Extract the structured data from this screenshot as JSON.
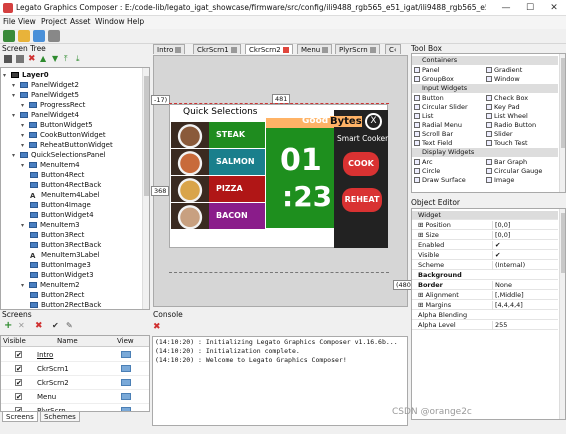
{
  "window": {
    "title": "Legato Graphics Composer : E:/code-lib/legato_igat_showcase/firmware/src/config/ili9488_rgb565_e51_igat/ili9488_rgb565_e51_igat_desig...",
    "minimize": "—",
    "maximize": "☐",
    "close": "✕"
  },
  "menu": [
    "File",
    "View",
    "Project",
    "Asset",
    "Window",
    "Help"
  ],
  "screen_tree": {
    "title": "Screen Tree",
    "items": [
      {
        "label": "Layer0",
        "type": "layer",
        "indent": 0
      },
      {
        "label": "PanelWidget2",
        "type": "widget",
        "indent": 1
      },
      {
        "label": "PanelWidget5",
        "type": "widget",
        "indent": 1
      },
      {
        "label": "ProgressRect",
        "type": "widget",
        "indent": 2
      },
      {
        "label": "PanelWidget4",
        "type": "widget",
        "indent": 1
      },
      {
        "label": "ButtonWidget5",
        "type": "widget",
        "indent": 2
      },
      {
        "label": "CookButtonWidget",
        "type": "widget",
        "indent": 2
      },
      {
        "label": "ReheatButtonWidget",
        "type": "widget",
        "indent": 2
      },
      {
        "label": "QuickSelectionsPanel",
        "type": "widget",
        "indent": 1
      },
      {
        "label": "MenuItem4",
        "type": "widget",
        "indent": 2
      },
      {
        "label": "Button4Rect",
        "type": "widget",
        "indent": 3
      },
      {
        "label": "Button4RectBack",
        "type": "widget",
        "indent": 3
      },
      {
        "label": "MenuItem4Label",
        "type": "label",
        "indent": 3
      },
      {
        "label": "Button4Image",
        "type": "widget",
        "indent": 3
      },
      {
        "label": "ButtonWidget4",
        "type": "widget",
        "indent": 3
      },
      {
        "label": "MenuItem3",
        "type": "widget",
        "indent": 2
      },
      {
        "label": "Button3Rect",
        "type": "widget",
        "indent": 3
      },
      {
        "label": "Button3RectBack",
        "type": "widget",
        "indent": 3
      },
      {
        "label": "MenuItem3Label",
        "type": "label",
        "indent": 3
      },
      {
        "label": "ButtonImage3",
        "type": "widget",
        "indent": 3
      },
      {
        "label": "ButtonWidget3",
        "type": "widget",
        "indent": 3
      },
      {
        "label": "MenuItem2",
        "type": "widget",
        "indent": 2
      },
      {
        "label": "Button2Rect",
        "type": "widget",
        "indent": 3
      },
      {
        "label": "Button2RectBack",
        "type": "widget",
        "indent": 3
      }
    ]
  },
  "tabs": [
    {
      "label": "Intro",
      "active": false
    },
    {
      "label": "CkrScrn1",
      "active": false
    },
    {
      "label": "CkrScrn2",
      "active": true
    },
    {
      "label": "Menu",
      "active": false
    },
    {
      "label": "PlyrScrn",
      "active": false
    },
    {
      "label": "C‹",
      "active": false
    }
  ],
  "canvas": {
    "ruler_width": "481",
    "ruler_height": "368",
    "ruler_left": "-17)",
    "ruler_right": "(480",
    "quick_selections_title": "Quick Selections",
    "menu_items": [
      {
        "label": "STEAK",
        "color": "#1f8c1f",
        "thumb": "#8a5a3a"
      },
      {
        "label": "SALMON",
        "color": "#1a7f8c",
        "thumb": "#c86a3a"
      },
      {
        "label": "PIZZA",
        "color": "#b01616",
        "thumb": "#d9a44a"
      },
      {
        "label": "BACON",
        "color": "#8a1c8a",
        "thumb": "#c8a080"
      }
    ],
    "timer_header": "Good",
    "timer_minutes": "01",
    "timer_seconds": ":23",
    "brand": "Bytes",
    "brand_sub": "Smart Cooker",
    "close_glyph": "X",
    "cook_label": "COOK",
    "reheat_label": "REHEAT"
  },
  "screens": {
    "title": "Screens",
    "columns": [
      "Visible",
      "Name",
      "View"
    ],
    "rows": [
      {
        "name": "Intro",
        "visible": true
      },
      {
        "name": "CkrScrn1",
        "visible": true
      },
      {
        "name": "CkrScrn2",
        "visible": true
      },
      {
        "name": "Menu",
        "visible": true
      },
      {
        "name": "PlyrScrn",
        "visible": true
      }
    ],
    "bottom_tabs": [
      "Screens",
      "Schemes"
    ]
  },
  "console": {
    "title": "Console",
    "lines": [
      "(14:10:20) : Initializing Legato Graphics Composer v1.16.6b...",
      "(14:10:20) : Initialization complete.",
      "(14:10:20) : Welcome to Legato Graphics Composer!"
    ]
  },
  "toolbox": {
    "title": "Tool Box",
    "groups": [
      {
        "name": "Containers",
        "items": [
          "Panel",
          "Gradient",
          "GroupBox",
          "Window"
        ]
      },
      {
        "name": "Input Widgets",
        "items": [
          "Button",
          "Check Box",
          "Circular Slider",
          "Key Pad",
          "List",
          "List Wheel",
          "Radial Menu",
          "Radio Button",
          "Scroll Bar",
          "Slider",
          "Text Field",
          "Touch Test"
        ]
      },
      {
        "name": "Display Widgets",
        "items": [
          "Arc",
          "Bar Graph",
          "Circle",
          "Circular Gauge",
          "Draw Surface",
          "Image"
        ]
      }
    ]
  },
  "object_editor": {
    "title": "Object Editor",
    "rows": [
      {
        "key": "Widget",
        "value": "",
        "group": true
      },
      {
        "key": "⊞ Position",
        "value": "[0,0]",
        "group": false
      },
      {
        "key": "⊞ Size",
        "value": "[0,0]",
        "group": false
      },
      {
        "key": "Enabled",
        "value": "✔",
        "group": false
      },
      {
        "key": "Visible",
        "value": "✔",
        "group": false
      },
      {
        "key": "Scheme",
        "value": "(Internal)",
        "group": false
      },
      {
        "key": "Background",
        "value": "",
        "group": false
      },
      {
        "key": "Border",
        "value": "None",
        "group": false
      },
      {
        "key": "⊞ Alignment",
        "value": "[,Middle]",
        "group": false
      },
      {
        "key": "⊞ Margins",
        "value": "[4,4,4,4]",
        "group": false
      },
      {
        "key": "Alpha Blending",
        "value": "",
        "group": false
      },
      {
        "key": "Alpha Level",
        "value": "255",
        "group": false
      }
    ]
  },
  "watermark": "CSDN @orange2c"
}
